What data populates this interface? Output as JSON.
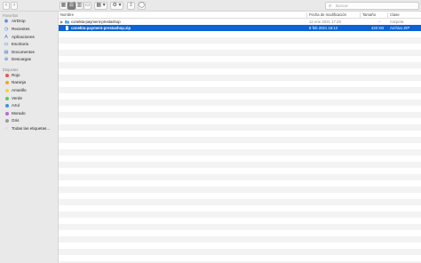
{
  "toolbar": {
    "back_glyph": "‹",
    "forward_glyph": "›",
    "view_buttons": [
      {
        "name": "icon-view-button",
        "glyph": "▦"
      },
      {
        "name": "list-view-button",
        "glyph": "☰"
      },
      {
        "name": "column-view-button",
        "glyph": "▥"
      },
      {
        "name": "gallery-view-button",
        "glyph": "▭"
      }
    ],
    "group_glyph": "▦ ▾",
    "action_glyph": "⚙ ▾",
    "share_glyph": "⇪",
    "tag_glyph": "◯",
    "search_icon": "⌕",
    "search_placeholder": "Buscar"
  },
  "sidebar": {
    "favorites_title": "Favoritos",
    "favorites": [
      {
        "label": "AirDrop",
        "icon": "airdrop-icon",
        "glyph": "◉"
      },
      {
        "label": "Recientes",
        "icon": "clock-icon",
        "glyph": "◷"
      },
      {
        "label": "Aplicaciones",
        "icon": "applications-icon",
        "glyph": "A"
      },
      {
        "label": "Escritorio",
        "icon": "desktop-icon",
        "glyph": "▭"
      },
      {
        "label": "Documentos",
        "icon": "documents-icon",
        "glyph": "▤"
      },
      {
        "label": "Descargas",
        "icon": "downloads-icon",
        "glyph": "⊕"
      }
    ],
    "tags_title": "Etiquetas",
    "tags": [
      {
        "label": "Rojo",
        "color": "#f0524f"
      },
      {
        "label": "Naranja",
        "color": "#f5a623"
      },
      {
        "label": "Amarillo",
        "color": "#f7d23e"
      },
      {
        "label": "Verde",
        "color": "#5ec75a"
      },
      {
        "label": "Azul",
        "color": "#3f8ff5"
      },
      {
        "label": "Morado",
        "color": "#b46ad8"
      },
      {
        "label": "Gris",
        "color": "#9b9b9b"
      }
    ],
    "all_tags": {
      "label": "Todas las etiquetas...",
      "glyph": "◌"
    }
  },
  "table": {
    "columns": {
      "name": "Nombre",
      "date": "Fecha de modificación",
      "size": "Tamaño",
      "kind": "Clase"
    },
    "rows": [
      {
        "name": "conekta-payment-prestashop",
        "date": "12 ene 2021 17:29",
        "size": "--",
        "kind": "Carpeta",
        "type": "folder",
        "selected": false
      },
      {
        "name": "conekta-payment-prestashop.zip",
        "date": "8 feb 2021 18:12",
        "size": "420 KB",
        "kind": "Archivo ZIP",
        "type": "zip",
        "selected": true
      }
    ]
  },
  "colors": {
    "selection": "#0b63d6",
    "folder": "#5aa9ea"
  }
}
